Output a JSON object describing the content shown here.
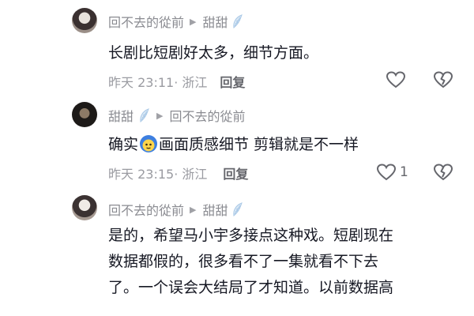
{
  "comments": [
    {
      "author": "回不去的從前",
      "reply_to": "甜甜",
      "text": "长剧比短剧好太多，细节方面。",
      "time": "昨天 23:11",
      "location": "· 浙江",
      "reply_label": "回复",
      "like_count": ""
    },
    {
      "author": "甜甜",
      "reply_to": "回不去的從前",
      "text_before": "确实",
      "text_after": "画面质感细节  剪辑就是不一样",
      "time": "昨天 23:15",
      "location": "· 浙江",
      "reply_label": "回复",
      "like_count": "1"
    },
    {
      "author": "回不去的從前",
      "reply_to": "甜甜",
      "lines": [
        "是的，希望马小宇多接点这种戏。短剧现在",
        "数据都假的，很多看不了一集就看不下去",
        "了。一个误会大结局了才知道。以前数据高"
      ]
    }
  ],
  "colors": {
    "text": "#161823",
    "meta": "#9a9ba1",
    "icon": "#65666c",
    "wing": "#a9c8e6"
  }
}
